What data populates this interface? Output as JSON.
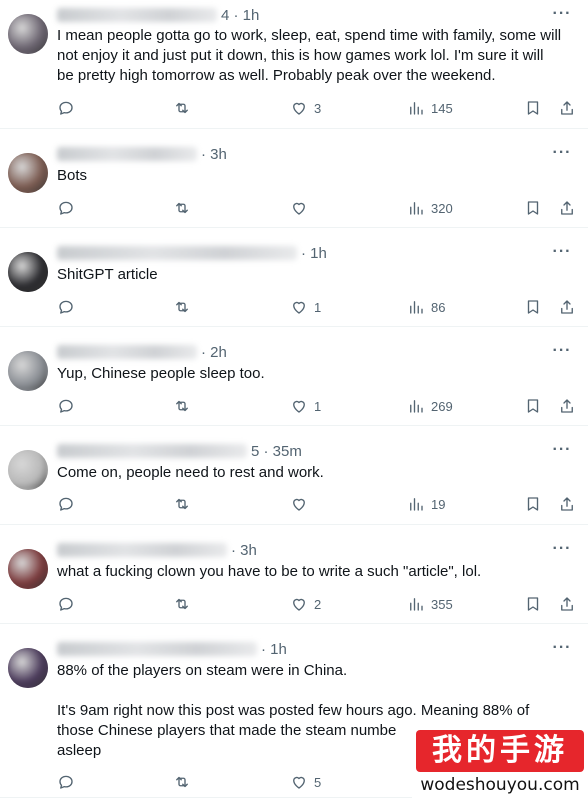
{
  "icons": {
    "reply": "reply-icon",
    "retweet": "retweet-icon",
    "like": "heart-icon",
    "views": "views-icon",
    "bookmark": "bookmark-icon",
    "share": "share-icon",
    "more": "more-icon"
  },
  "more_label": "···",
  "tweets": [
    {
      "time": "4 · 1h",
      "text": "I mean people gotta go to work, sleep, eat, spend time with family, some will not enjoy it and just put it down, this is how games work lol. I'm sure it will be pretty high tomorrow as well. Probably peak over the weekend.",
      "likes": "3",
      "views": "145",
      "avatar_color": "#6b6470"
    },
    {
      "time": "· 3h",
      "text": "Bots",
      "likes": "",
      "views": "320",
      "avatar_color": "#7a5a50"
    },
    {
      "time": "· 1h",
      "text": "ShitGPT article",
      "likes": "1",
      "views": "86",
      "avatar_color": "#2a2a2e"
    },
    {
      "time": "· 2h",
      "text": "Yup, Chinese people sleep too.",
      "likes": "1",
      "views": "269",
      "avatar_color": "#8a8e94"
    },
    {
      "time": "5 · 35m",
      "text": "Come on, people need to rest and work.",
      "likes": "",
      "views": "19",
      "avatar_color": "#b8b8b8"
    },
    {
      "time": "· 3h",
      "text": "what a fucking clown you have to be to write a such \"article\", lol.",
      "likes": "2",
      "views": "355",
      "avatar_color": "#7a3a3c"
    },
    {
      "time": "· 1h",
      "text": "88% of the players on steam were in China.\n\nIt's 9am right now this post was posted few hours ago. Meaning 88% of those Chinese players that made the steam numbe\nasleep",
      "likes": "5",
      "views": "",
      "avatar_color": "#4a3a5a"
    }
  ],
  "watermark": {
    "brand": "我的手游",
    "domain": "wodeshouyou.com"
  }
}
